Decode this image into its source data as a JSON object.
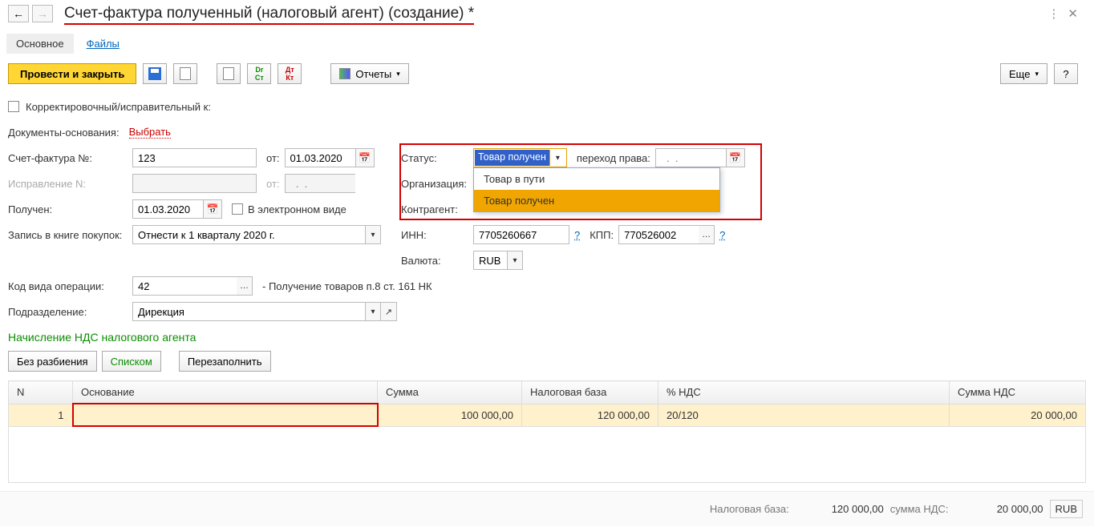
{
  "header": {
    "title": "Счет-фактура полученный (налоговый агент) (создание) *"
  },
  "tabs": {
    "main": "Основное",
    "files": "Файлы"
  },
  "toolbar": {
    "post_close": "Провести и закрыть",
    "reports": "Отчеты",
    "more": "Еще",
    "help": "?"
  },
  "form": {
    "corr_label": "Корректировочный/исправительный к:",
    "basis_docs_label": "Документы-основания:",
    "basis_select": "Выбрать",
    "invoice_num_label": "Счет-фактура №:",
    "invoice_num": "123",
    "from_label": "от:",
    "invoice_date": "01.03.2020",
    "correction_label": "Исправление N:",
    "correction_date_placeholder": "  .  .",
    "received_label": "Получен:",
    "received_date": "01.03.2020",
    "eform_label": "В электронном виде",
    "book_label": "Запись в книге покупок:",
    "book_value": "Отнести к 1 кварталу 2020 г.",
    "opcode_label": "Код вида операции:",
    "opcode_value": "42",
    "opcode_desc": "- Получение товаров п.8 ст. 161 НК",
    "dept_label": "Подразделение:",
    "dept_value": "Дирекция"
  },
  "right": {
    "status_label": "Статус:",
    "status_value": "Товар получен",
    "transfer_label": "переход права:",
    "transfer_placeholder": "  .  .",
    "org_label": "Организация:",
    "contractor_label": "Контрагент:",
    "inn_label": "ИНН:",
    "inn_value": "7705260667",
    "kpp_label": "КПП:",
    "kpp_value": "770526002",
    "currency_label": "Валюта:",
    "currency_value": "RUB",
    "dropdown_options": [
      "Товар в пути",
      "Товар получен"
    ]
  },
  "section": {
    "title": "Начисление НДС налогового агента",
    "btn_split": "Без разбиения",
    "btn_list": "Списком",
    "btn_refill": "Перезаполнить"
  },
  "table": {
    "cols": {
      "n": "N",
      "basis": "Основание",
      "sum": "Сумма",
      "tax_base": "Налоговая база",
      "vat_rate": "% НДС",
      "vat_sum": "Сумма НДС"
    },
    "rows": [
      {
        "n": "1",
        "basis": "",
        "sum": "100 000,00",
        "tax_base": "120 000,00",
        "vat_rate": "20/120",
        "vat_sum": "20 000,00"
      }
    ]
  },
  "totals": {
    "tax_base_label": "Налоговая база:",
    "tax_base": "120 000,00",
    "vat_label": "сумма НДС:",
    "vat": "20 000,00",
    "currency": "RUB"
  }
}
